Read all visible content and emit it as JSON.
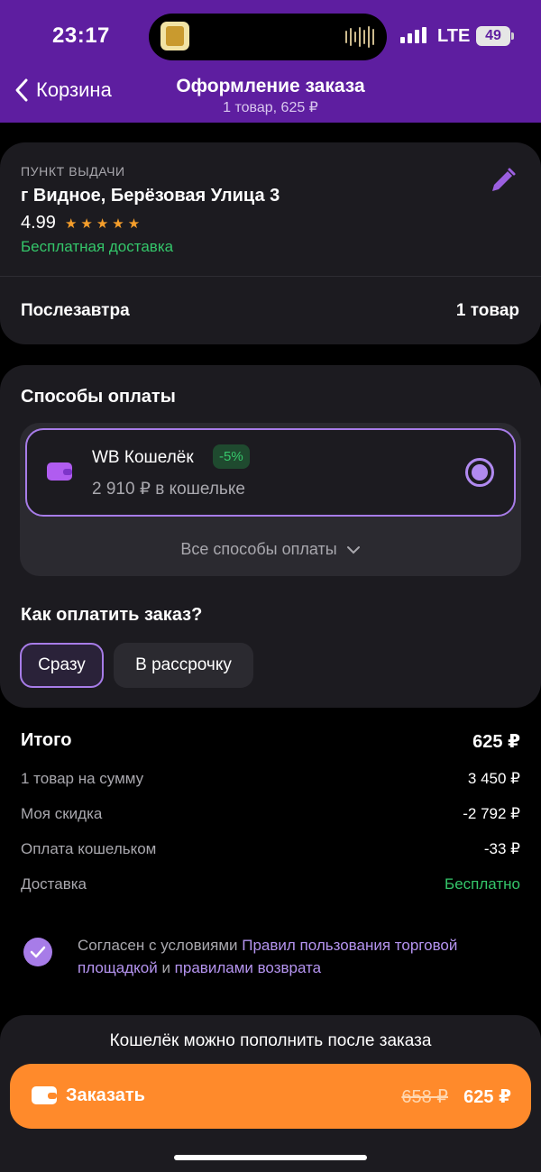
{
  "status": {
    "time": "23:17",
    "network": "LTE",
    "battery": "49"
  },
  "nav": {
    "back_label": "Корзина",
    "title": "Оформление заказа",
    "subtitle": "1 товар, 625 ₽"
  },
  "pickup": {
    "caption": "ПУНКТ ВЫДАЧИ",
    "address": "г Видное, Берёзовая Улица 3",
    "rating": "4.99",
    "stars": 5,
    "delivery": "Бесплатная доставка",
    "day": "Послезавтра",
    "items": "1 товар"
  },
  "payment": {
    "title": "Способы оплаты",
    "wallet_name": "WB Кошелёк",
    "wallet_badge": "-5%",
    "wallet_balance": "2 910 ₽ в кошельке",
    "all_methods": "Все способы оплаты",
    "how_title": "Как оплатить заказ?",
    "option_now": "Сразу",
    "option_installment": "В рассрочку"
  },
  "totals": {
    "label": "Итого",
    "value": "625 ₽",
    "rows": [
      {
        "label": "1 товар на сумму",
        "value": "3 450 ₽"
      },
      {
        "label": "Моя скидка",
        "value": "-2 792 ₽"
      },
      {
        "label": "Оплата кошельком",
        "value": "-33 ₽"
      },
      {
        "label": "Доставка",
        "value": "Бесплатно"
      }
    ]
  },
  "agreement": {
    "prefix": "Согласен с условиями ",
    "link1": "Правил пользования торговой площадкой",
    "middle": " и ",
    "link2": "правилами возврата"
  },
  "order": {
    "hint": "Кошелёк можно пополнить после заказа",
    "button_label": "Заказать",
    "old_price": "658 ₽",
    "new_price": "625 ₽"
  },
  "colors": {
    "accent": "#a77ce8",
    "header": "#5e1ea0",
    "order_button": "#ff8a2b",
    "success": "#34c66a"
  }
}
